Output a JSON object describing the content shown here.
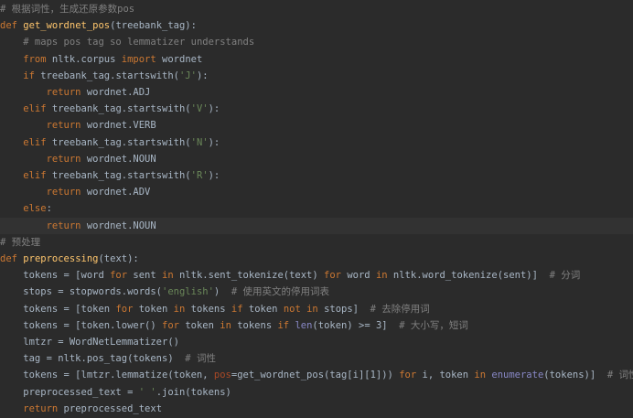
{
  "lines": [
    {
      "parts": [
        {
          "t": "# 根据词性，生成还原参数pos",
          "c": "cm"
        }
      ]
    },
    {
      "parts": [
        {
          "t": "def ",
          "c": "kw"
        },
        {
          "t": "get_wordnet_pos",
          "c": "fn"
        },
        {
          "t": "(treebank_tag):",
          "c": ""
        }
      ]
    },
    {
      "parts": [
        {
          "t": "    # maps pos tag so ",
          "c": "cm"
        },
        {
          "t": "lemmatizer",
          "c": "cm"
        },
        {
          "t": " understands",
          "c": "cm"
        }
      ]
    },
    {
      "parts": [
        {
          "t": "    from ",
          "c": "kw"
        },
        {
          "t": "nltk.corpus ",
          "c": ""
        },
        {
          "t": "import ",
          "c": "kw"
        },
        {
          "t": "wordnet",
          "c": ""
        }
      ]
    },
    {
      "parts": [
        {
          "t": "    if ",
          "c": "kw"
        },
        {
          "t": "treebank_tag.startswith(",
          "c": ""
        },
        {
          "t": "'J'",
          "c": "str"
        },
        {
          "t": "):",
          "c": ""
        }
      ]
    },
    {
      "parts": [
        {
          "t": "        return ",
          "c": "kw"
        },
        {
          "t": "wordnet.ADJ",
          "c": ""
        }
      ]
    },
    {
      "parts": [
        {
          "t": "    elif ",
          "c": "kw"
        },
        {
          "t": "treebank_tag.startswith(",
          "c": ""
        },
        {
          "t": "'V'",
          "c": "str"
        },
        {
          "t": "):",
          "c": ""
        }
      ]
    },
    {
      "parts": [
        {
          "t": "        return ",
          "c": "kw"
        },
        {
          "t": "wordnet.VERB",
          "c": ""
        }
      ]
    },
    {
      "parts": [
        {
          "t": "    elif ",
          "c": "kw"
        },
        {
          "t": "treebank_tag.startswith(",
          "c": ""
        },
        {
          "t": "'N'",
          "c": "str"
        },
        {
          "t": "):",
          "c": ""
        }
      ]
    },
    {
      "parts": [
        {
          "t": "        return ",
          "c": "kw"
        },
        {
          "t": "wordnet.NOUN",
          "c": ""
        }
      ]
    },
    {
      "parts": [
        {
          "t": "    elif ",
          "c": "kw"
        },
        {
          "t": "treebank_tag.startswith(",
          "c": ""
        },
        {
          "t": "'R'",
          "c": "str"
        },
        {
          "t": "):",
          "c": ""
        }
      ]
    },
    {
      "parts": [
        {
          "t": "        return ",
          "c": "kw"
        },
        {
          "t": "wordnet.ADV",
          "c": ""
        }
      ]
    },
    {
      "parts": [
        {
          "t": "    else",
          "c": "kw"
        },
        {
          "t": ":",
          "c": ""
        }
      ]
    },
    {
      "parts": [
        {
          "t": "        return ",
          "c": "kw"
        },
        {
          "t": "wordnet.NOUN",
          "c": ""
        }
      ],
      "current": true
    },
    {
      "parts": [
        {
          "t": "# 预处理",
          "c": "cm"
        }
      ]
    },
    {
      "parts": [
        {
          "t": "def ",
          "c": "kw"
        },
        {
          "t": "preprocessing",
          "c": "fn"
        },
        {
          "t": "(text):",
          "c": ""
        }
      ]
    },
    {
      "parts": [
        {
          "t": "    tokens = [word ",
          "c": ""
        },
        {
          "t": "for ",
          "c": "kw"
        },
        {
          "t": "sent ",
          "c": ""
        },
        {
          "t": "in ",
          "c": "kw"
        },
        {
          "t": "nltk.sent_tokenize(text) ",
          "c": ""
        },
        {
          "t": "for ",
          "c": "kw"
        },
        {
          "t": "word ",
          "c": ""
        },
        {
          "t": "in ",
          "c": "kw"
        },
        {
          "t": "nltk.word_tokenize(sent)]  ",
          "c": ""
        },
        {
          "t": "# 分词",
          "c": "cm"
        }
      ]
    },
    {
      "parts": [
        {
          "t": "    stops = stopwords.words(",
          "c": ""
        },
        {
          "t": "'english'",
          "c": "str"
        },
        {
          "t": ")  ",
          "c": ""
        },
        {
          "t": "# 使用英文的停用词表",
          "c": "cm"
        }
      ]
    },
    {
      "parts": [
        {
          "t": "    tokens = [token ",
          "c": ""
        },
        {
          "t": "for ",
          "c": "kw"
        },
        {
          "t": "token ",
          "c": ""
        },
        {
          "t": "in ",
          "c": "kw"
        },
        {
          "t": "tokens ",
          "c": ""
        },
        {
          "t": "if ",
          "c": "kw"
        },
        {
          "t": "token ",
          "c": ""
        },
        {
          "t": "not in ",
          "c": "kw"
        },
        {
          "t": "stops]  ",
          "c": ""
        },
        {
          "t": "# 去除停用词",
          "c": "cm"
        }
      ]
    },
    {
      "parts": [
        {
          "t": "    tokens = [token.lower() ",
          "c": ""
        },
        {
          "t": "for ",
          "c": "kw"
        },
        {
          "t": "token ",
          "c": ""
        },
        {
          "t": "in ",
          "c": "kw"
        },
        {
          "t": "tokens ",
          "c": ""
        },
        {
          "t": "if ",
          "c": "kw"
        },
        {
          "t": "len",
          "c": "bi"
        },
        {
          "t": "(token) >= 3]  ",
          "c": ""
        },
        {
          "t": "# 大小写，短词",
          "c": "cm"
        }
      ]
    },
    {
      "parts": [
        {
          "t": "    lmtzr = WordNetLemmatizer()",
          "c": ""
        }
      ]
    },
    {
      "parts": [
        {
          "t": "    tag = nltk.pos_tag(tokens)  ",
          "c": ""
        },
        {
          "t": "# 词性",
          "c": "cm"
        }
      ]
    },
    {
      "parts": [
        {
          "t": "    tokens = [lmtzr.lemmatize(token, ",
          "c": ""
        },
        {
          "t": "pos",
          "c": "pm"
        },
        {
          "t": "=get_wordnet_pos(tag[i][1])) ",
          "c": ""
        },
        {
          "t": "for ",
          "c": "kw"
        },
        {
          "t": "i, token ",
          "c": ""
        },
        {
          "t": "in ",
          "c": "kw"
        },
        {
          "t": "enumerate",
          "c": "bi"
        },
        {
          "t": "(tokens)]  ",
          "c": ""
        },
        {
          "t": "# 词性还原",
          "c": "cm"
        }
      ]
    },
    {
      "parts": [
        {
          "t": "    preprocessed_text = ",
          "c": ""
        },
        {
          "t": "' '",
          "c": "str"
        },
        {
          "t": ".join(tokens)",
          "c": ""
        }
      ]
    },
    {
      "parts": [
        {
          "t": "    return ",
          "c": "kw"
        },
        {
          "t": "preprocessed_text",
          "c": ""
        }
      ]
    }
  ]
}
